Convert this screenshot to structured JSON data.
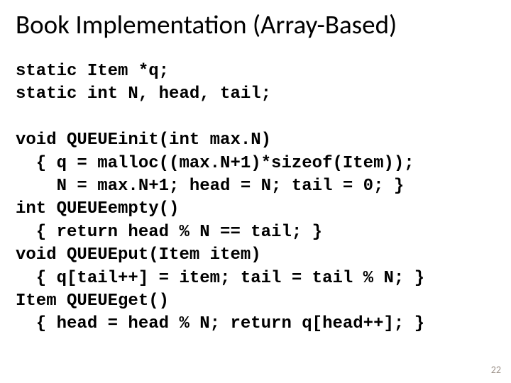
{
  "title": "Book Implementation (Array-Based)",
  "code": [
    "static Item *q;",
    "static int N, head, tail;",
    "",
    "void QUEUEinit(int max.N)",
    "  { q = malloc((max.N+1)*sizeof(Item));",
    "    N = max.N+1; head = N; tail = 0; }",
    "int QUEUEempty()",
    "  { return head % N == tail; }",
    "void QUEUEput(Item item)",
    "  { q[tail++] = item; tail = tail % N; }",
    "Item QUEUEget()",
    "  { head = head % N; return q[head++]; }"
  ],
  "page_number": "22"
}
